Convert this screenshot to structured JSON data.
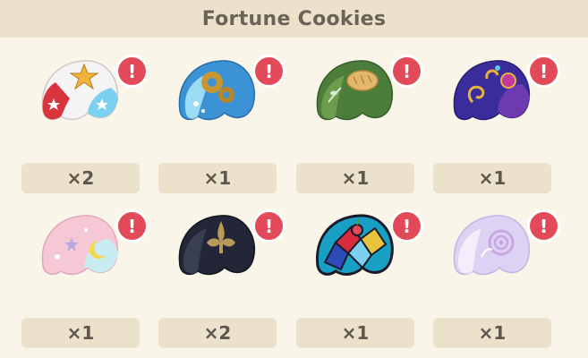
{
  "header": {
    "title": "Fortune Cookies"
  },
  "cookies": [
    {
      "name": "star-fortune-cookie",
      "count": "×2",
      "alert": "!",
      "colors": [
        "#d8343c",
        "#f4f4f4",
        "#7ad0ee"
      ]
    },
    {
      "name": "gear-fortune-cookie",
      "count": "×1",
      "alert": "!",
      "colors": [
        "#3b92d4",
        "#9adcf4",
        "#b8862a"
      ]
    },
    {
      "name": "bread-fortune-cookie",
      "count": "×1",
      "alert": "!",
      "colors": [
        "#4c7d3a",
        "#6c9c4c",
        "#e3b86e"
      ]
    },
    {
      "name": "ornate-fortune-cookie",
      "count": "×1",
      "alert": "!",
      "colors": [
        "#3b2c9c",
        "#6e3ab0",
        "#e6b43c"
      ]
    },
    {
      "name": "moon-fortune-cookie",
      "count": "×1",
      "alert": "!",
      "colors": [
        "#f6c8d6",
        "#c9ecf2",
        "#f4d84c"
      ]
    },
    {
      "name": "fleur-fortune-cookie",
      "count": "×2",
      "alert": "!",
      "colors": [
        "#222636",
        "#3a3e52",
        "#b89a5a"
      ]
    },
    {
      "name": "stained-glass-cookie",
      "count": "×1",
      "alert": "!",
      "colors": [
        "#18a0c4",
        "#d82c3c",
        "#1a1a2a"
      ]
    },
    {
      "name": "rose-fortune-cookie",
      "count": "×1",
      "alert": "!",
      "colors": [
        "#dcd2f4",
        "#f4eefc",
        "#c8a6e0"
      ]
    }
  ]
}
